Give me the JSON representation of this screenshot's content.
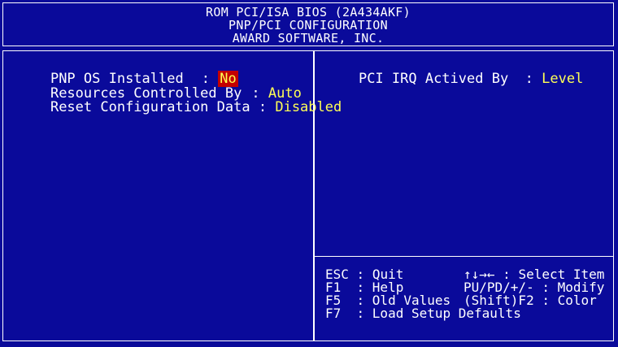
{
  "header": {
    "line1": "ROM PCI/ISA BIOS (2A434AKF)",
    "line2": "PNP/PCI CONFIGURATION",
    "line3": "AWARD SOFTWARE, INC."
  },
  "left_panel": {
    "items": [
      {
        "label": "PNP OS Installed",
        "sep": ":",
        "value": "No"
      },
      {
        "label": "Resources Controlled By",
        "sep": ":",
        "value": "Auto"
      },
      {
        "label": "Reset Configuration Data",
        "sep": ":",
        "value": "Disabled"
      }
    ]
  },
  "right_panel": {
    "items": [
      {
        "label": "PCI IRQ Actived By",
        "sep": ":",
        "value": "Level"
      }
    ]
  },
  "help": {
    "esc_key": "ESC",
    "esc_text": ": Quit",
    "f1_key": "F1",
    "f1_text": ": Help",
    "f5_key": "F5",
    "f5_text": ": Old Values",
    "f7_key": "F7",
    "f7_text": ": Load Setup Defaults",
    "arrows": "↑↓→←",
    "arrows_text": ": Select Item",
    "pu_text": "PU/PD/+/- : Modify",
    "shift_text": "(Shift)F2 : Color"
  },
  "colors": {
    "background": "#0a0a9a",
    "value_text": "#ffff55",
    "selected_bg": "#c40000"
  }
}
